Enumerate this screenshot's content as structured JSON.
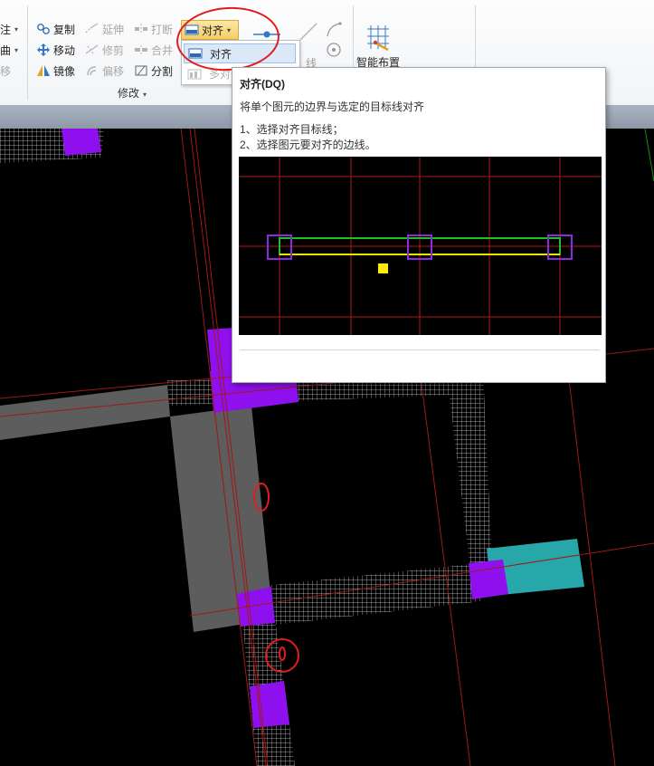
{
  "ribbon": {
    "left_partial": [
      {
        "label": "注",
        "caret": "▾"
      },
      {
        "label": "曲",
        "caret": "▾"
      },
      {
        "label": "移"
      }
    ],
    "col1": [
      {
        "label": "复制",
        "icon": "copy-icon"
      },
      {
        "label": "移动",
        "icon": "move-icon"
      },
      {
        "label": "镜像",
        "icon": "mirror-icon"
      }
    ],
    "col2": [
      {
        "label": "延伸",
        "icon": "extend-icon"
      },
      {
        "label": "修剪",
        "icon": "trim-icon"
      },
      {
        "label": "偏移",
        "icon": "offset-icon"
      }
    ],
    "col3": [
      {
        "label": "打断",
        "icon": "break-icon"
      },
      {
        "label": "合并",
        "icon": "merge-icon"
      },
      {
        "label": "分割",
        "icon": "split-icon"
      }
    ],
    "align_button": {
      "label": "对齐",
      "caret": "▾"
    },
    "align_dropdown": {
      "item1": "对齐",
      "item2": "多对齐"
    },
    "partial_line_label": "线",
    "smart_layout": {
      "label": "智能布置",
      "icon": "smart-layout-icon"
    },
    "group_label": "修改",
    "group_caret": "▾"
  },
  "tooltip": {
    "title": "对齐(DQ)",
    "description": "将单个图元的边界与选定的目标线对齐",
    "step1": "1、选择对齐目标线；",
    "step2": "2、选择图元要对齐的边线。"
  },
  "colors": {
    "canvas_bg": "#000000",
    "axis_red": "#a01818",
    "column_purple": "#8f10ee",
    "beam_gray": "#5d5d5d",
    "teal": "#27a7a9",
    "annotation_red": "#e21d1d",
    "ribbon_bg": "#f5f6f8",
    "hover_yellow": "#f6d173"
  }
}
